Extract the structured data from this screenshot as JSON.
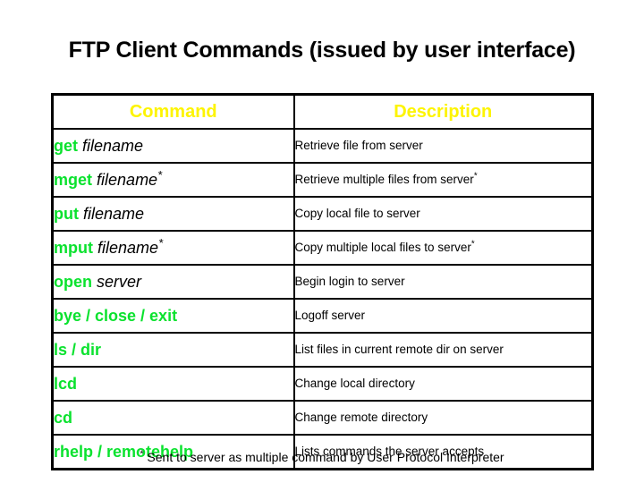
{
  "slide": {
    "title": "FTP Client Commands (issued by user interface)",
    "footnote_marker": "*",
    "footnote_text": "Sent to server as multiple command by User Protocol Interpreter"
  },
  "colors": {
    "command_keyword": "#0ae22e",
    "header_text": "#fdf400",
    "body_text": "#000000",
    "background": "#ffffff",
    "border": "#000000"
  },
  "table": {
    "headers": {
      "command": "Command",
      "description": "Description"
    },
    "rows": [
      {
        "command_keyword": "get",
        "command_arg": "filename",
        "command_arg_star": "",
        "command_full": "get filename",
        "description": "Retrieve file from server",
        "description_star": ""
      },
      {
        "command_keyword": "mget",
        "command_arg": "filename",
        "command_arg_star": "*",
        "command_full": "mget filename*",
        "description": "Retrieve multiple files from server",
        "description_star": "*"
      },
      {
        "command_keyword": "put",
        "command_arg": "filename",
        "command_arg_star": "",
        "command_full": "put filename",
        "description": "Copy local file to server",
        "description_star": ""
      },
      {
        "command_keyword": "mput",
        "command_arg": "filename",
        "command_arg_star": "*",
        "command_full": "mput filename*",
        "description": "Copy multiple local files to server",
        "description_star": "*"
      },
      {
        "command_keyword": "open",
        "command_arg": "server",
        "command_arg_star": "",
        "command_full": "open server",
        "description": "Begin login to server",
        "description_star": ""
      },
      {
        "command_keyword": "bye / close / exit",
        "command_arg": "",
        "command_arg_star": "",
        "command_full": "bye / close / exit",
        "description": "Logoff server",
        "description_star": ""
      },
      {
        "command_keyword": "ls / dir",
        "command_arg": "",
        "command_arg_star": "",
        "command_full": "ls / dir",
        "description": "List files in current remote dir on server",
        "description_star": ""
      },
      {
        "command_keyword": "lcd",
        "command_arg": "",
        "command_arg_star": "",
        "command_full": "lcd",
        "description": "Change local directory",
        "description_star": ""
      },
      {
        "command_keyword": "cd",
        "command_arg": "",
        "command_arg_star": "",
        "command_full": "cd",
        "description": "Change remote directory",
        "description_star": ""
      },
      {
        "command_keyword": "rhelp / remotehelp",
        "command_arg": "",
        "command_arg_star": "",
        "command_full": "rhelp / remotehelp",
        "description": "Lists commands the server accepts",
        "description_star": ""
      }
    ]
  }
}
